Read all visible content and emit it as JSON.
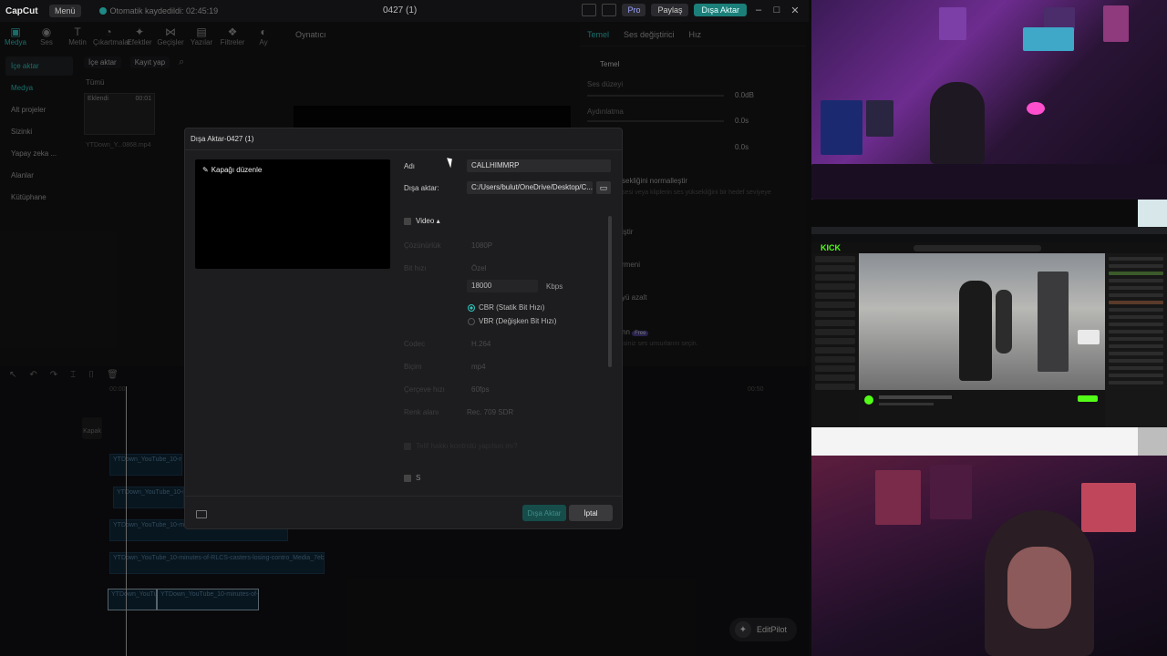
{
  "titlebar": {
    "logo": "CapCut",
    "menu_label": "Menü",
    "autosave": "Otomatik kaydedildi: 02:45:19",
    "project_title": "0427 (1)",
    "pro_label": "Pro",
    "share_label": "Paylaş",
    "export_label": "Dışa Aktar"
  },
  "toolbar": [
    {
      "label": "Medya",
      "icon": "media-icon"
    },
    {
      "label": "Ses",
      "icon": "audio-icon"
    },
    {
      "label": "Metin",
      "icon": "text-icon"
    },
    {
      "label": "Çıkartmalar",
      "icon": "sticker-icon"
    },
    {
      "label": "Efektler",
      "icon": "effects-icon"
    },
    {
      "label": "Geçişler",
      "icon": "transition-icon"
    },
    {
      "label": "Yazılar",
      "icon": "captions-icon"
    },
    {
      "label": "Filtreler",
      "icon": "filter-icon"
    },
    {
      "label": "Ay",
      "icon": "adjust-icon"
    }
  ],
  "leftnav": [
    "İçe aktar",
    "Medya",
    "Alt projeler",
    "Sizinki",
    "Yapay zeka ...",
    "Alanlar",
    "Kütüphane"
  ],
  "media": {
    "import_label": "İçe aktar",
    "record_label": "Kayıt yap",
    "all_label": "Tümü",
    "added_label": "Eklendi",
    "duration": "00:01",
    "file_label": "YTDown_Y...0868.mp4"
  },
  "player": {
    "title": "Oynatıcı"
  },
  "props": {
    "tabs": [
      "Temel",
      "Ses değiştirici",
      "Hız"
    ],
    "section": "Temel",
    "volume_label": "Ses düzeyi",
    "volume_value": "0.0dB",
    "fade_in_label": "Aydınlatma",
    "fade_in_value": "0.0s",
    "fade_out_value": "0.0s",
    "normalize_label": "sekliğini normalleştir",
    "normalize_desc": "sesi veya kliplerin ses yüksekliğini bir hedef seviyeye",
    "item_1": "iştir",
    "item_2": "rmeni",
    "item_3": "yü azalt",
    "item_4": "nn",
    "item_4_badge": "Free",
    "item_4_desc": "isiniz ses unsurlarını seçin."
  },
  "timeline": {
    "cover_label": "Kapak",
    "tc_start": "00:00",
    "tc_end": "00:50",
    "clips": [
      "YTDown_YouTube_10-minut",
      "YTDown_YouTube_10-m",
      "YTDown_YouTube_10-minut",
      "YTDown_YouTube_10-minutes-of-RLCS-casters-losing-contro_Media_7eb0Zl...",
      "YTDown_YouTu",
      "YTDown_YouTube_10-minutes-of-R"
    ],
    "editpilot": "EditPilot"
  },
  "dialog": {
    "title": "Dışa Aktar-0427 (1)",
    "edit_cover": "Kapağı düzenle",
    "name_label": "Adı",
    "name_value": "CALLHIMMRP",
    "export_to_label": "Dışa aktar:",
    "export_path": "C:/Users/bulut/OneDrive/Desktop/C...",
    "video_label": "Video",
    "resolution_label": "Çözünürlük",
    "resolution_value": "1080P",
    "bitrate_label": "Bit hızı",
    "bitrate_value": "Özel",
    "bitrate_number": "18000",
    "bitrate_unit": "Kbps",
    "cbr_label": "CBR (Statik Bit Hızı)",
    "vbr_label": "VBR (Değişken Bit Hızı)",
    "codec_label": "Codec",
    "codec_value": "H.264",
    "format_label": "Biçim",
    "format_value": "mp4",
    "fps_label": "Çerçeve hızı",
    "fps_value": "60fps",
    "color_label": "Renk alanı",
    "color_value": "Rec. 709 SDR",
    "optimize_label": "Telif hakkı kontrolü yapılsın mı?",
    "audio_label": "S",
    "export_btn": "Dışa Aktar",
    "cancel_btn": "İptal"
  },
  "stream": {
    "logo": "KICK"
  },
  "colors": {
    "accent": "#2fc6be",
    "kick_green": "#53fc18"
  }
}
